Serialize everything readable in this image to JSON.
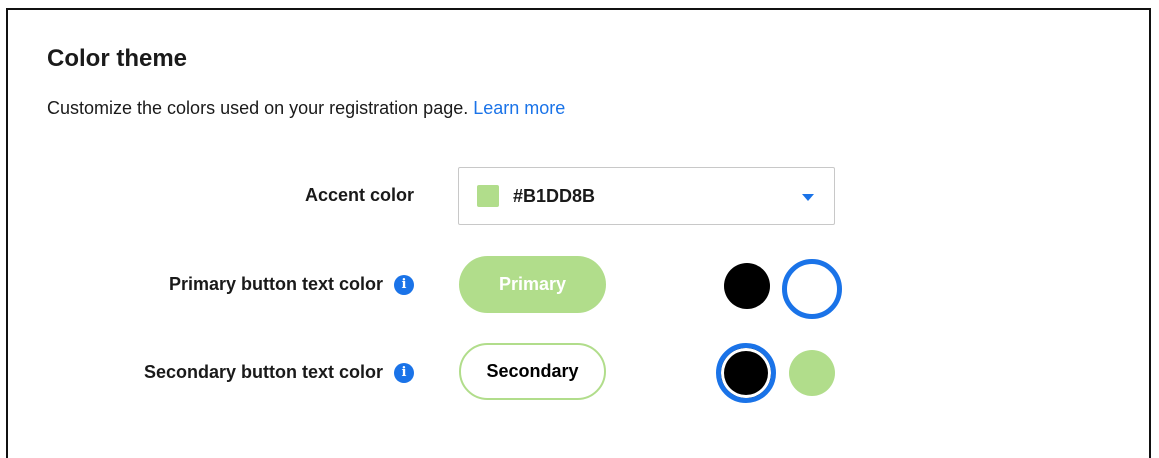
{
  "section": {
    "title": "Color theme",
    "description": "Customize the colors used on your registration page.",
    "learn_more": "Learn more"
  },
  "accent": {
    "label": "Accent color",
    "value": "#B1DD8B",
    "swatch_color": "#B1DD8B",
    "dropdown_icon": "caret-down-icon"
  },
  "primary_text": {
    "label": "Primary button text color",
    "info_icon": "info-icon",
    "preview_label": "Primary",
    "preview_background": "#B1DD8B",
    "preview_text_color": "#FFFFFF",
    "options": [
      {
        "name": "black",
        "color": "#000000",
        "selected": false
      },
      {
        "name": "white",
        "color": "#FFFFFF",
        "selected": true
      }
    ]
  },
  "secondary_text": {
    "label": "Secondary button text color",
    "info_icon": "info-icon",
    "preview_label": "Secondary",
    "preview_border": "#B1DD8B",
    "preview_text_color": "#000000",
    "options": [
      {
        "name": "black",
        "color": "#000000",
        "selected": true
      },
      {
        "name": "accent",
        "color": "#B1DD8B",
        "selected": false
      }
    ]
  },
  "colors": {
    "link": "#1A73E8",
    "selection_ring": "#1A73E8"
  }
}
